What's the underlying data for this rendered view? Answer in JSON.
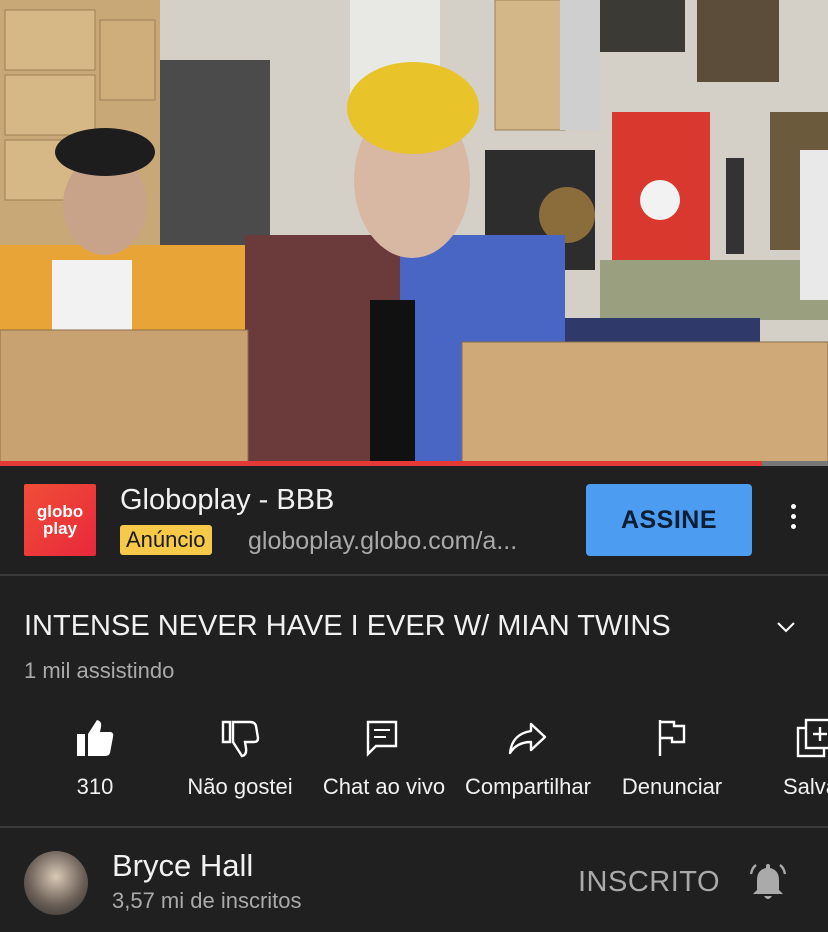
{
  "ad": {
    "logo_line1": "globo",
    "logo_line2": "play",
    "title": "Globoplay - BBB",
    "badge": "Anúncio",
    "url": "globoplay.globo.com/a...",
    "cta": "ASSINE"
  },
  "video": {
    "title": "INTENSE NEVER HAVE I EVER W/ MIAN TWINS",
    "views": "1 mil assistindo",
    "progress": 0.92
  },
  "actions": [
    {
      "label": "310",
      "icon": "thumbs-up-icon"
    },
    {
      "label": "Não gostei",
      "icon": "thumbs-down-icon"
    },
    {
      "label": "Chat ao vivo",
      "icon": "chat-icon"
    },
    {
      "label": "Compartilhar",
      "icon": "share-icon"
    },
    {
      "label": "Denunciar",
      "icon": "flag-icon"
    },
    {
      "label": "Salvar",
      "icon": "add-to-playlist-icon"
    }
  ],
  "channel": {
    "name": "Bryce Hall",
    "subscribers": "3,57 mi de inscritos",
    "status": "INSCRITO"
  }
}
